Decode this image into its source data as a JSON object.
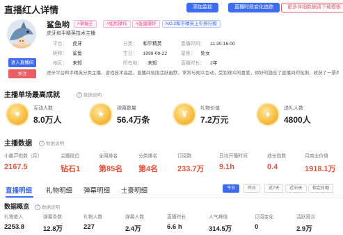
{
  "header": {
    "title": "直播红人详情",
    "btn_tracking": "添加监控",
    "btn_hourly": "直播时段变化追踪",
    "btn_more": "更多详细数据请下载模板"
  },
  "profile": {
    "nickname": "鲨鱼哟",
    "tags": [
      "#掌握王",
      "#如厉操作",
      "#蛋蛋爆炸"
    ],
    "rank_tag": "NO.2和平精英上午排行榜",
    "subtitle": "虎牙和平精英技术主播",
    "btn_live": "进入直播间",
    "btn_follow": "关注",
    "info": [
      {
        "label": "平台：",
        "value": "虎牙"
      },
      {
        "label": "分类：",
        "value": "和平精英"
      },
      {
        "label": "直播时间：",
        "value": "11:30-16:00"
      },
      {
        "label": "昵称：",
        "value": "鲨鱼"
      },
      {
        "label": "生日：",
        "value": "1999-09-22"
      },
      {
        "label": "星座：",
        "value": "处女"
      },
      {
        "label": "地区：",
        "value": "未知"
      },
      {
        "label": "所在地：",
        "value": "未知"
      },
      {
        "label": "直播时长：",
        "value": "2年"
      }
    ],
    "description": "虎牙平台和平精英分类主播，游戏技术高超，直播间氛围活跃幽默，常常与观众互动，受到观众的喜爱，你好的融合了直播间的氛围，收获了一票死忠粉"
  },
  "highlights": {
    "title": "主播单场最高成就",
    "note": "数据说明",
    "cards": [
      {
        "icon": "♥",
        "label": "互动人数",
        "value": "8.0万人"
      },
      {
        "icon": "★",
        "label": "弹幕数量",
        "value": "56.4万条"
      },
      {
        "icon": "¥",
        "label": "礼物价值",
        "value": "7.2万元"
      },
      {
        "icon": "♦",
        "label": "送礼人数",
        "value": "4800人"
      }
    ]
  },
  "anchor_data": {
    "title": "主播数据",
    "note": "数据说明",
    "metrics": [
      {
        "label": "小鹏芦指数（月）",
        "value": "2167.5"
      },
      {
        "label": "主播段位",
        "value": "钻石1"
      },
      {
        "label": "全网排名",
        "value": "第85名"
      },
      {
        "label": "分类排名",
        "value": "第4名"
      },
      {
        "label": "订阅数",
        "value": "233.7万"
      },
      {
        "label": "日均开播时间",
        "value": "9.1h"
      },
      {
        "label": "成长指数",
        "value": "0.4"
      },
      {
        "label": "月商业价值",
        "value": "1918.1万"
      }
    ]
  },
  "tabs": [
    "直播明细",
    "礼物明细",
    "弹幕明细",
    "土豪明细"
  ],
  "ranges": [
    "今日",
    "昨日",
    "近7天",
    "近30天",
    "指定日期"
  ],
  "overview": {
    "title": "数据概览",
    "note": "数据说明",
    "items": [
      {
        "label": "礼物收入",
        "value": "2253.8"
      },
      {
        "label": "弹幕条数",
        "value": "12.8万"
      },
      {
        "label": "礼物人数",
        "value": "227"
      },
      {
        "label": "弹幕人数",
        "value": "2.4万"
      },
      {
        "label": "直播时长",
        "value": "6.6 h"
      },
      {
        "label": "人气峰值",
        "value": "314.5万"
      },
      {
        "label": "订阅变化",
        "value": "0"
      },
      {
        "label": "活跃观众",
        "value": "2.9万"
      }
    ]
  }
}
